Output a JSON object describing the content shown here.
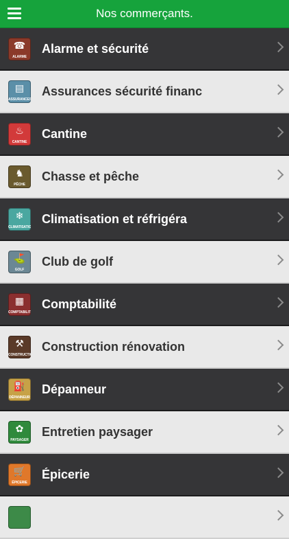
{
  "header": {
    "title": "Nos commerçants.",
    "menu_icon": "hamburger-icon"
  },
  "colors": {
    "header_bg": "#16a33c",
    "row_dark": "#353537",
    "row_light": "#e9e9e9"
  },
  "items": [
    {
      "label": "Alarme et sécurité",
      "icon_caption": "alarme\nSÉCURITÉ",
      "icon": "alarm-icon",
      "icon_color": "#8b3a2a"
    },
    {
      "label": "Assurances sécurité financ",
      "icon_caption": "ASSURANCES",
      "icon": "insurance-icon",
      "icon_color": "#5b8fa8"
    },
    {
      "label": "Cantine",
      "icon_caption": "CANTINE",
      "icon": "cantine-icon",
      "icon_color": "#d23a3a"
    },
    {
      "label": "Chasse et pêche",
      "icon_caption": "chasse & PÊCHE",
      "icon": "deer-icon",
      "icon_color": "#6a5a2e"
    },
    {
      "label": "Climatisation et réfrigéra",
      "icon_caption": "CLIMATISATION",
      "icon": "climatisation-icon",
      "icon_color": "#4aa7a0"
    },
    {
      "label": "Club de golf",
      "icon_caption": "GOLF",
      "icon": "golf-icon",
      "icon_color": "#6b8794"
    },
    {
      "label": "Comptabilité",
      "icon_caption": "COMPTABILITÉ",
      "icon": "calculator-icon",
      "icon_color": "#8b2f2f"
    },
    {
      "label": "Construction rénovation",
      "icon_caption": "CONSTRUCTION",
      "icon": "hammer-icon",
      "icon_color": "#5a3a28"
    },
    {
      "label": "Dépanneur",
      "icon_caption": "DÉPANNEUR",
      "icon": "store-icon",
      "icon_color": "#c7a247"
    },
    {
      "label": "Entretien paysager",
      "icon_caption": "ENTRETIEN PAYSAGER",
      "icon": "mower-icon",
      "icon_color": "#2f8a3c"
    },
    {
      "label": "Épicerie",
      "icon_caption": "ÉPICERIE",
      "icon": "cart-icon",
      "icon_color": "#e0782a"
    },
    {
      "label": "",
      "icon_caption": "",
      "icon": "partial-icon",
      "icon_color": "#3d8a48"
    }
  ]
}
